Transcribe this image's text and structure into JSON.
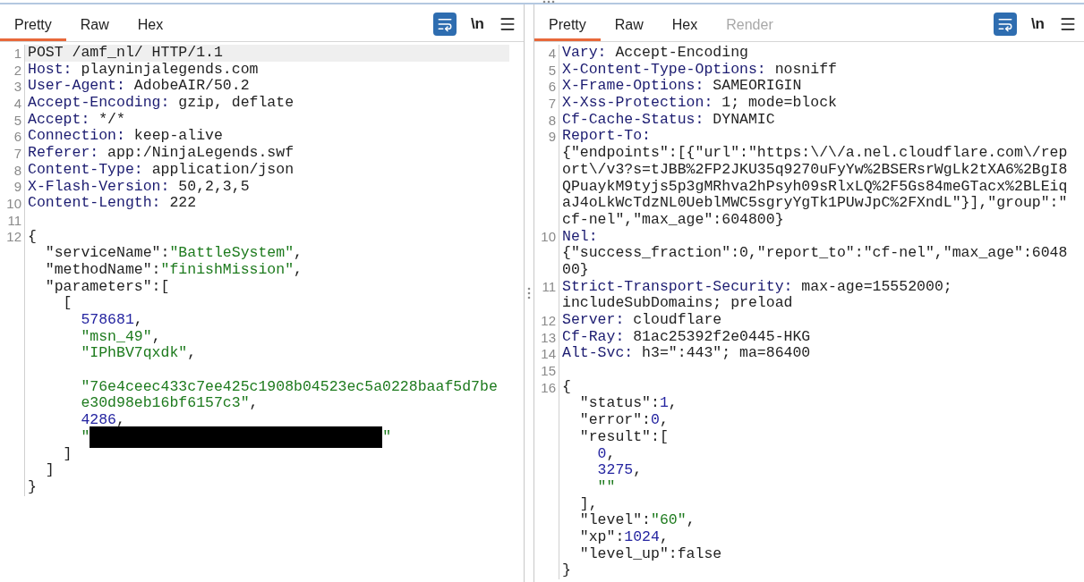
{
  "panels": [
    {
      "tabs": [
        {
          "label": "Pretty",
          "selected": true,
          "disabled": false
        },
        {
          "label": "Raw",
          "selected": false,
          "disabled": false
        },
        {
          "label": "Hex",
          "selected": false,
          "disabled": false
        }
      ],
      "toolbar": {
        "wrap_on": true,
        "newline_label": "\\n"
      },
      "lines": [
        {
          "n": "1",
          "highlighted": true,
          "tokens": [
            {
              "kind": "plain",
              "text": "POST /amf_nl/ HTTP/1.1"
            }
          ]
        },
        {
          "n": "2",
          "highlighted": false,
          "tokens": [
            {
              "kind": "name",
              "text": "Host:"
            },
            {
              "kind": "plain",
              "text": " playninjalegends.com"
            }
          ]
        },
        {
          "n": "3",
          "highlighted": false,
          "tokens": [
            {
              "kind": "name",
              "text": "User-Agent:"
            },
            {
              "kind": "plain",
              "text": " AdobeAIR/50.2"
            }
          ]
        },
        {
          "n": "4",
          "highlighted": false,
          "tokens": [
            {
              "kind": "name",
              "text": "Accept-Encoding:"
            },
            {
              "kind": "plain",
              "text": " gzip, deflate"
            }
          ]
        },
        {
          "n": "5",
          "highlighted": false,
          "tokens": [
            {
              "kind": "name",
              "text": "Accept:"
            },
            {
              "kind": "plain",
              "text": " */*"
            }
          ]
        },
        {
          "n": "6",
          "highlighted": false,
          "tokens": [
            {
              "kind": "name",
              "text": "Connection:"
            },
            {
              "kind": "plain",
              "text": " keep-alive"
            }
          ]
        },
        {
          "n": "7",
          "highlighted": false,
          "tokens": [
            {
              "kind": "name",
              "text": "Referer:"
            },
            {
              "kind": "plain",
              "text": " app:/NinjaLegends.swf"
            }
          ]
        },
        {
          "n": "8",
          "highlighted": false,
          "tokens": [
            {
              "kind": "name",
              "text": "Content-Type:"
            },
            {
              "kind": "plain",
              "text": " application/json"
            }
          ]
        },
        {
          "n": "9",
          "highlighted": false,
          "tokens": [
            {
              "kind": "name",
              "text": "X-Flash-Version:"
            },
            {
              "kind": "plain",
              "text": " 50,2,3,5"
            }
          ]
        },
        {
          "n": "10",
          "highlighted": false,
          "tokens": [
            {
              "kind": "name",
              "text": "Content-Length:"
            },
            {
              "kind": "plain",
              "text": " 222"
            }
          ]
        },
        {
          "n": "11",
          "highlighted": false
        },
        {
          "n": "12",
          "highlighted": false,
          "tokens": [
            {
              "kind": "plain",
              "text": "{"
            }
          ]
        },
        {
          "highlighted": false,
          "tokens": [
            {
              "kind": "plain",
              "text": "  \"serviceName\":"
            },
            {
              "kind": "str",
              "text": "\"BattleSystem\""
            },
            {
              "kind": "plain",
              "text": ","
            }
          ]
        },
        {
          "highlighted": false,
          "tokens": [
            {
              "kind": "plain",
              "text": "  \"methodName\":"
            },
            {
              "kind": "str",
              "text": "\"finishMission\""
            },
            {
              "kind": "plain",
              "text": ","
            }
          ]
        },
        {
          "highlighted": false,
          "tokens": [
            {
              "kind": "plain",
              "text": "  \"parameters\":["
            }
          ]
        },
        {
          "highlighted": false,
          "tokens": [
            {
              "kind": "plain",
              "text": "    ["
            }
          ]
        },
        {
          "highlighted": false,
          "tokens": [
            {
              "kind": "num",
              "text": "      578681"
            },
            {
              "kind": "plain",
              "text": ","
            }
          ]
        },
        {
          "highlighted": false,
          "tokens": [
            {
              "kind": "str",
              "text": "      \"msn_49\""
            },
            {
              "kind": "plain",
              "text": ","
            }
          ]
        },
        {
          "highlighted": false,
          "tokens": [
            {
              "kind": "str",
              "text": "      \"IPhBV7qxdk\""
            },
            {
              "kind": "plain",
              "text": ","
            }
          ]
        },
        {
          "highlighted": false
        },
        {
          "highlighted": false,
          "tokens": [
            {
              "kind": "str",
              "text": "      \"76e4ceec433c7ee425c1908b04523ec5a0228baaf5d7be"
            }
          ]
        },
        {
          "highlighted": false,
          "tokens": [
            {
              "kind": "str",
              "text": "      e30d98eb16bf6157c3\""
            },
            {
              "kind": "plain",
              "text": ","
            }
          ]
        },
        {
          "highlighted": false,
          "tokens": [
            {
              "kind": "num",
              "text": "      4286"
            },
            {
              "kind": "plain",
              "text": ","
            }
          ]
        },
        {
          "highlighted": false,
          "tokens": [
            {
              "kind": "str",
              "text": "      \""
            },
            {
              "kind": "redacted"
            },
            {
              "kind": "str",
              "text": "\""
            }
          ]
        },
        {
          "highlighted": false,
          "tokens": [
            {
              "kind": "plain",
              "text": "    ]"
            }
          ]
        },
        {
          "highlighted": false,
          "tokens": [
            {
              "kind": "plain",
              "text": "  ]"
            }
          ]
        },
        {
          "highlighted": false,
          "tokens": [
            {
              "kind": "plain",
              "text": "}"
            }
          ]
        }
      ]
    },
    {
      "tabs": [
        {
          "label": "Pretty",
          "selected": true,
          "disabled": false
        },
        {
          "label": "Raw",
          "selected": false,
          "disabled": false
        },
        {
          "label": "Hex",
          "selected": false,
          "disabled": false
        },
        {
          "label": "Render",
          "selected": false,
          "disabled": true
        }
      ],
      "toolbar": {
        "wrap_on": true,
        "newline_label": "\\n"
      },
      "lines": [
        {
          "n": "4",
          "highlighted": false,
          "tokens": [
            {
              "kind": "name",
              "text": "Vary:"
            },
            {
              "kind": "plain",
              "text": " Accept-Encoding"
            }
          ]
        },
        {
          "n": "5",
          "highlighted": false,
          "tokens": [
            {
              "kind": "name",
              "text": "X-Content-Type-Options:"
            },
            {
              "kind": "plain",
              "text": " nosniff"
            }
          ]
        },
        {
          "n": "6",
          "highlighted": false,
          "tokens": [
            {
              "kind": "name",
              "text": "X-Frame-Options:"
            },
            {
              "kind": "plain",
              "text": " SAMEORIGIN"
            }
          ]
        },
        {
          "n": "7",
          "highlighted": false,
          "tokens": [
            {
              "kind": "name",
              "text": "X-Xss-Protection:"
            },
            {
              "kind": "plain",
              "text": " 1; mode=block"
            }
          ]
        },
        {
          "n": "8",
          "highlighted": false,
          "tokens": [
            {
              "kind": "name",
              "text": "Cf-Cache-Status:"
            },
            {
              "kind": "plain",
              "text": " DYNAMIC"
            }
          ]
        },
        {
          "n": "9",
          "highlighted": false,
          "tokens": [
            {
              "kind": "name",
              "text": "Report-To:"
            }
          ]
        },
        {
          "highlighted": false,
          "tokens": [
            {
              "kind": "plain",
              "text": "{\"endpoints\":[{\"url\":\"https:\\/\\/a.nel.cloudflare.com\\/rep"
            }
          ]
        },
        {
          "highlighted": false,
          "tokens": [
            {
              "kind": "plain",
              "text": "ort\\/v3?s=tJBB%2FP2JKU35q9270uFyYw%2BSERsrWgLk2tXA6%2BgI8"
            }
          ]
        },
        {
          "highlighted": false,
          "tokens": [
            {
              "kind": "plain",
              "text": "QPuaykM9tyjs5p3gMRhva2hPsyh09sRlxLQ%2F5Gs84meGTacx%2BLEiq"
            }
          ]
        },
        {
          "highlighted": false,
          "tokens": [
            {
              "kind": "plain",
              "text": "aJ4oLkWcTdzNL0UeblMWC5sgryYgTk1PUwJpC%2FXndL\"}],\"group\":\""
            }
          ]
        },
        {
          "highlighted": false,
          "tokens": [
            {
              "kind": "plain",
              "text": "cf-nel\",\"max_age\":604800}"
            }
          ]
        },
        {
          "n": "10",
          "highlighted": false,
          "tokens": [
            {
              "kind": "name",
              "text": "Nel:"
            }
          ]
        },
        {
          "highlighted": false,
          "tokens": [
            {
              "kind": "plain",
              "text": "{\"success_fraction\":0,\"report_to\":\"cf-nel\",\"max_age\":6048"
            }
          ]
        },
        {
          "highlighted": false,
          "tokens": [
            {
              "kind": "plain",
              "text": "00}"
            }
          ]
        },
        {
          "n": "11",
          "highlighted": false,
          "tokens": [
            {
              "kind": "name",
              "text": "Strict-Transport-Security:"
            },
            {
              "kind": "plain",
              "text": " max-age=15552000;"
            }
          ]
        },
        {
          "highlighted": false,
          "tokens": [
            {
              "kind": "plain",
              "text": "includeSubDomains; preload"
            }
          ]
        },
        {
          "n": "12",
          "highlighted": false,
          "tokens": [
            {
              "kind": "name",
              "text": "Server:"
            },
            {
              "kind": "plain",
              "text": " cloudflare"
            }
          ]
        },
        {
          "n": "13",
          "highlighted": false,
          "tokens": [
            {
              "kind": "name",
              "text": "Cf-Ray:"
            },
            {
              "kind": "plain",
              "text": " 81ac25392f2e0445-HKG"
            }
          ]
        },
        {
          "n": "14",
          "highlighted": false,
          "tokens": [
            {
              "kind": "name",
              "text": "Alt-Svc:"
            },
            {
              "kind": "plain",
              "text": " h3=\":443\"; ma=86400"
            }
          ]
        },
        {
          "n": "15",
          "highlighted": false
        },
        {
          "n": "16",
          "highlighted": false,
          "tokens": [
            {
              "kind": "plain",
              "text": "{"
            }
          ]
        },
        {
          "highlighted": false,
          "tokens": [
            {
              "kind": "plain",
              "text": "  \"status\":"
            },
            {
              "kind": "num",
              "text": "1"
            },
            {
              "kind": "plain",
              "text": ","
            }
          ]
        },
        {
          "highlighted": false,
          "tokens": [
            {
              "kind": "plain",
              "text": "  \"error\":"
            },
            {
              "kind": "num",
              "text": "0"
            },
            {
              "kind": "plain",
              "text": ","
            }
          ]
        },
        {
          "highlighted": false,
          "tokens": [
            {
              "kind": "plain",
              "text": "  \"result\":["
            }
          ]
        },
        {
          "highlighted": false,
          "tokens": [
            {
              "kind": "num",
              "text": "    0"
            },
            {
              "kind": "plain",
              "text": ","
            }
          ]
        },
        {
          "highlighted": false,
          "tokens": [
            {
              "kind": "num",
              "text": "    3275"
            },
            {
              "kind": "plain",
              "text": ","
            }
          ]
        },
        {
          "highlighted": false,
          "tokens": [
            {
              "kind": "str",
              "text": "    \"\""
            }
          ]
        },
        {
          "highlighted": false,
          "tokens": [
            {
              "kind": "plain",
              "text": "  ],"
            }
          ]
        },
        {
          "highlighted": false,
          "tokens": [
            {
              "kind": "plain",
              "text": "  \"level\":"
            },
            {
              "kind": "str",
              "text": "\"60\""
            },
            {
              "kind": "plain",
              "text": ","
            }
          ]
        },
        {
          "highlighted": false,
          "tokens": [
            {
              "kind": "plain",
              "text": "  \"xp\":"
            },
            {
              "kind": "num",
              "text": "1024"
            },
            {
              "kind": "plain",
              "text": ","
            }
          ]
        },
        {
          "highlighted": false,
          "tokens": [
            {
              "kind": "plain",
              "text": "  \"level_up\":false"
            }
          ]
        },
        {
          "highlighted": false,
          "tokens": [
            {
              "kind": "plain",
              "text": "}"
            }
          ]
        }
      ]
    }
  ]
}
